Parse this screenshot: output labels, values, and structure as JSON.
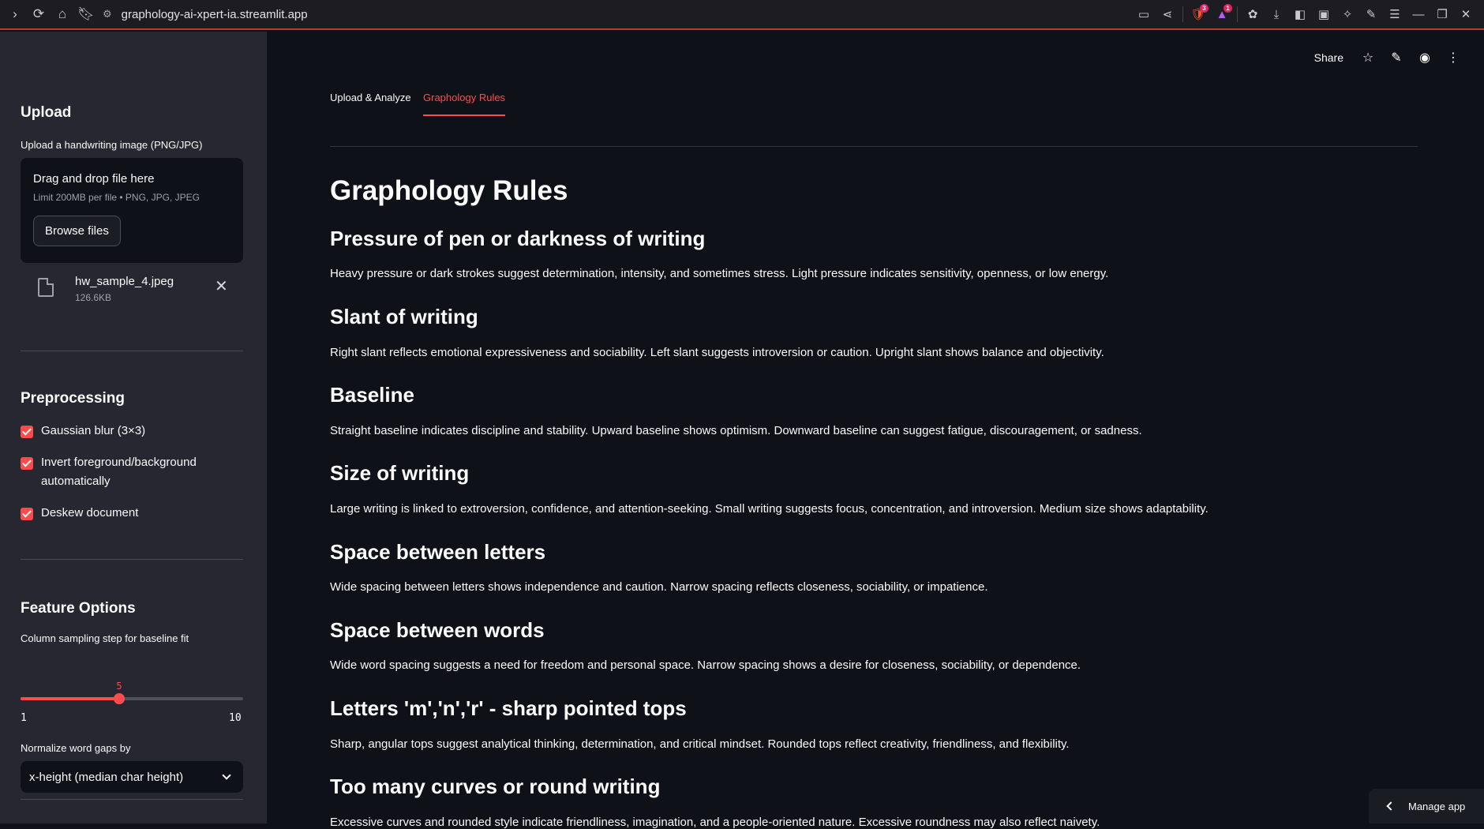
{
  "browser": {
    "url": "graphology-ai-xpert-ia.streamlit.app",
    "brave_badge": "3",
    "rewards_badge": "1"
  },
  "sidebar": {
    "upload_heading": "Upload",
    "upload_label": "Upload a handwriting image (PNG/JPG)",
    "dropzone_title": "Drag and drop file here",
    "dropzone_limit": "Limit 200MB per file • PNG, JPG, JPEG",
    "browse_label": "Browse files",
    "file": {
      "name": "hw_sample_4.jpeg",
      "size": "126.6KB"
    },
    "preprocessing_heading": "Preprocessing",
    "checkboxes": [
      {
        "label": "Gaussian blur (3×3)",
        "checked": true
      },
      {
        "label": "Invert foreground/background automatically",
        "checked": true
      },
      {
        "label": "Deskew document",
        "checked": true
      }
    ],
    "feature_heading": "Feature Options",
    "slider": {
      "label": "Column sampling step for baseline fit",
      "value": 5,
      "min": 1,
      "max": 10,
      "value_text": "5",
      "min_text": "1",
      "max_text": "10"
    },
    "select": {
      "label": "Normalize word gaps by",
      "value": "x-height (median char height)"
    }
  },
  "header": {
    "share_label": "Share"
  },
  "tabs": [
    {
      "label": "Upload & Analyze",
      "active": false
    },
    {
      "label": "Graphology Rules",
      "active": true
    }
  ],
  "content": {
    "title": "Graphology Rules",
    "rules": [
      {
        "heading": "Pressure of pen or darkness of writing",
        "text": "Heavy pressure or dark strokes suggest determination, intensity, and sometimes stress. Light pressure indicates sensitivity, openness, or low energy."
      },
      {
        "heading": "Slant of writing",
        "text": "Right slant reflects emotional expressiveness and sociability. Left slant suggests introversion or caution. Upright slant shows balance and objectivity."
      },
      {
        "heading": "Baseline",
        "text": "Straight baseline indicates discipline and stability. Upward baseline shows optimism. Downward baseline can suggest fatigue, discouragement, or sadness."
      },
      {
        "heading": "Size of writing",
        "text": "Large writing is linked to extroversion, confidence, and attention-seeking. Small writing suggests focus, concentration, and introversion. Medium size shows adaptability."
      },
      {
        "heading": "Space between letters",
        "text": "Wide spacing between letters shows independence and caution. Narrow spacing reflects closeness, sociability, or impatience."
      },
      {
        "heading": "Space between words",
        "text": "Wide word spacing suggests a need for freedom and personal space. Narrow spacing shows a desire for closeness, sociability, or dependence."
      },
      {
        "heading": "Letters 'm','n','r' - sharp pointed tops",
        "text": "Sharp, angular tops suggest analytical thinking, determination, and critical mindset. Rounded tops reflect creativity, friendliness, and flexibility."
      },
      {
        "heading": "Too many curves or round writing",
        "text": "Excessive curves and rounded style indicate friendliness, imagination, and a people-oriented nature. Excessive roundness may also reflect naivety."
      }
    ]
  },
  "manage_app": {
    "label": "Manage app"
  },
  "colors": {
    "accent": "#ff4b4b",
    "sidebar_bg": "#262730",
    "main_bg": "#0e1117"
  }
}
